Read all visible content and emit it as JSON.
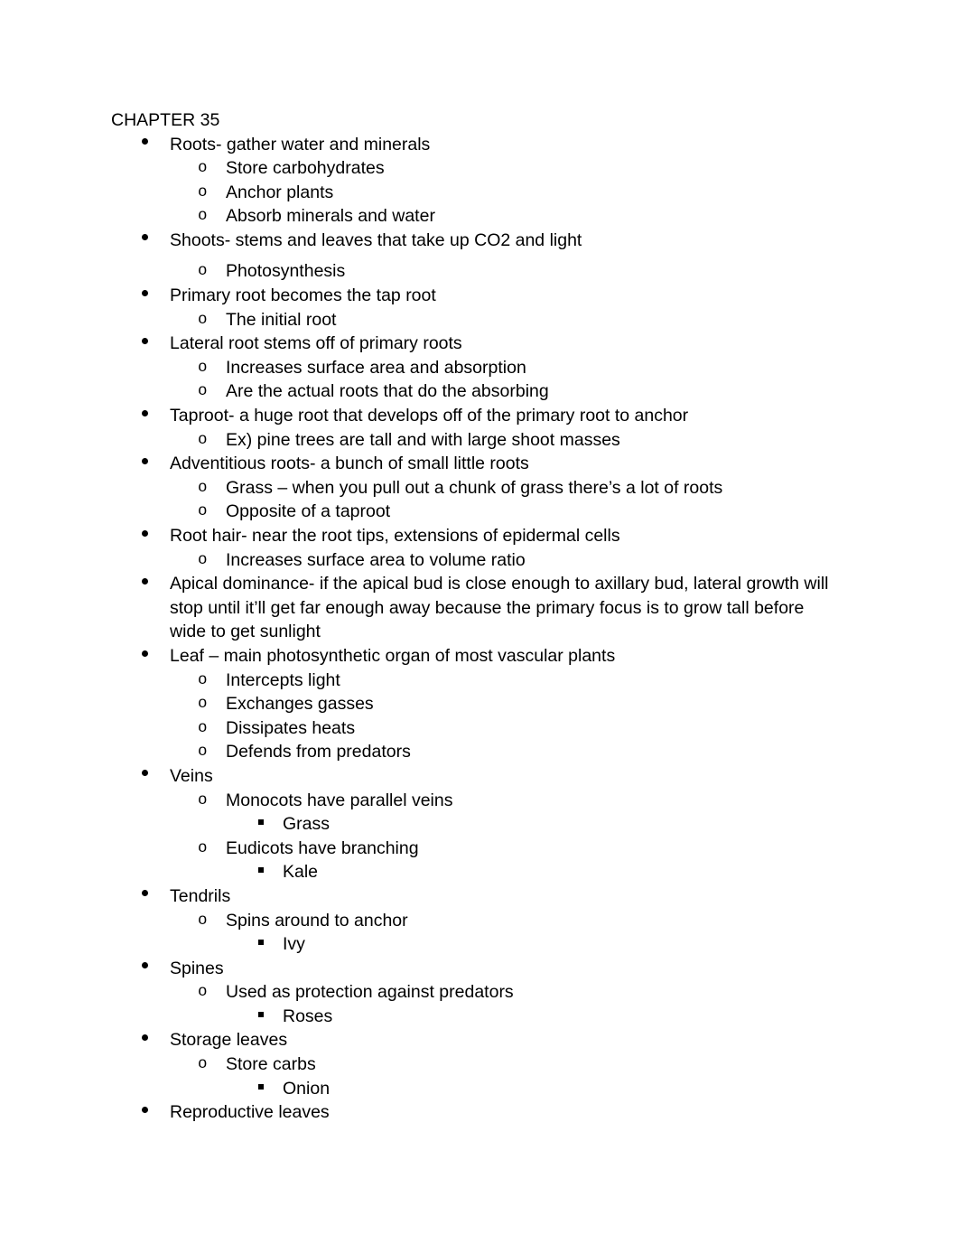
{
  "document": {
    "heading": "CHAPTER 35",
    "outline": [
      {
        "level": 1,
        "marker": "bullet",
        "text": "Roots- gather water and minerals",
        "gap_before": false
      },
      {
        "level": 2,
        "marker": "circle",
        "text": "Store carbohydrates",
        "gap_before": false
      },
      {
        "level": 2,
        "marker": "circle",
        "text": "Anchor plants",
        "gap_before": false
      },
      {
        "level": 2,
        "marker": "circle",
        "text": "Absorb minerals and water",
        "gap_before": false
      },
      {
        "level": 1,
        "marker": "bullet",
        "text": "Shoots- stems and leaves that take up CO2 and light",
        "gap_before": false
      },
      {
        "level": 2,
        "marker": "circle",
        "text": "Photosynthesis",
        "gap_before": true
      },
      {
        "level": 1,
        "marker": "bullet",
        "text": "Primary root becomes the tap root",
        "gap_before": false
      },
      {
        "level": 2,
        "marker": "circle",
        "text": "The initial root",
        "gap_before": false
      },
      {
        "level": 1,
        "marker": "bullet",
        "text": "Lateral root stems off of primary roots",
        "gap_before": false
      },
      {
        "level": 2,
        "marker": "circle",
        "text": "Increases surface area and absorption",
        "gap_before": false
      },
      {
        "level": 2,
        "marker": "circle",
        "text": "Are the actual roots that do the absorbing",
        "gap_before": false
      },
      {
        "level": 1,
        "marker": "bullet",
        "text": "Taproot- a huge root that develops off of the primary root to anchor",
        "gap_before": false
      },
      {
        "level": 2,
        "marker": "circle",
        "text": "Ex) pine trees are tall and with large shoot masses",
        "gap_before": false
      },
      {
        "level": 1,
        "marker": "bullet",
        "text": "Adventitious roots- a bunch of small little roots",
        "gap_before": false
      },
      {
        "level": 2,
        "marker": "circle",
        "text": "Grass – when you pull out a chunk of grass there’s a lot of roots",
        "gap_before": false
      },
      {
        "level": 2,
        "marker": "circle",
        "text": "Opposite of a taproot",
        "gap_before": false
      },
      {
        "level": 1,
        "marker": "bullet",
        "text": "Root hair- near the root tips, extensions of epidermal cells",
        "gap_before": false
      },
      {
        "level": 2,
        "marker": "circle",
        "text": "Increases surface area to volume ratio",
        "gap_before": false
      },
      {
        "level": 1,
        "marker": "bullet",
        "text": "Apical dominance- if the apical bud is close enough to axillary bud, lateral growth will stop until it’ll get far enough away because the primary focus is to grow tall before wide to get sunlight",
        "gap_before": false
      },
      {
        "level": 1,
        "marker": "bullet",
        "text": "Leaf – main photosynthetic organ of most vascular plants",
        "gap_before": false
      },
      {
        "level": 2,
        "marker": "circle",
        "text": "Intercepts light",
        "gap_before": false
      },
      {
        "level": 2,
        "marker": "circle",
        "text": "Exchanges gasses",
        "gap_before": false
      },
      {
        "level": 2,
        "marker": "circle",
        "text": "Dissipates heats",
        "gap_before": false
      },
      {
        "level": 2,
        "marker": "circle",
        "text": "Defends from predators",
        "gap_before": false
      },
      {
        "level": 1,
        "marker": "bullet",
        "text": "Veins",
        "gap_before": false
      },
      {
        "level": 2,
        "marker": "circle",
        "text": "Monocots have parallel veins",
        "gap_before": false
      },
      {
        "level": 3,
        "marker": "square",
        "text": "Grass",
        "gap_before": false
      },
      {
        "level": 2,
        "marker": "circle",
        "text": "Eudicots have branching",
        "gap_before": false
      },
      {
        "level": 3,
        "marker": "square",
        "text": "Kale",
        "gap_before": false
      },
      {
        "level": 1,
        "marker": "bullet",
        "text": "Tendrils",
        "gap_before": false
      },
      {
        "level": 2,
        "marker": "circle",
        "text": "Spins around to anchor",
        "gap_before": false
      },
      {
        "level": 3,
        "marker": "square",
        "text": "Ivy",
        "gap_before": false
      },
      {
        "level": 1,
        "marker": "bullet",
        "text": "Spines",
        "gap_before": false
      },
      {
        "level": 2,
        "marker": "circle",
        "text": "Used as protection against predators",
        "gap_before": false
      },
      {
        "level": 3,
        "marker": "square",
        "text": "Roses",
        "gap_before": false
      },
      {
        "level": 1,
        "marker": "bullet",
        "text": "Storage leaves",
        "gap_before": false
      },
      {
        "level": 2,
        "marker": "circle",
        "text": "Store carbs",
        "gap_before": false
      },
      {
        "level": 3,
        "marker": "square",
        "text": "Onion",
        "gap_before": false
      },
      {
        "level": 1,
        "marker": "bullet",
        "text": "Reproductive leaves",
        "gap_before": false
      }
    ],
    "markers": {
      "circle_glyph": "o"
    },
    "colors": {
      "text": "#000000",
      "background": "#ffffff"
    }
  }
}
